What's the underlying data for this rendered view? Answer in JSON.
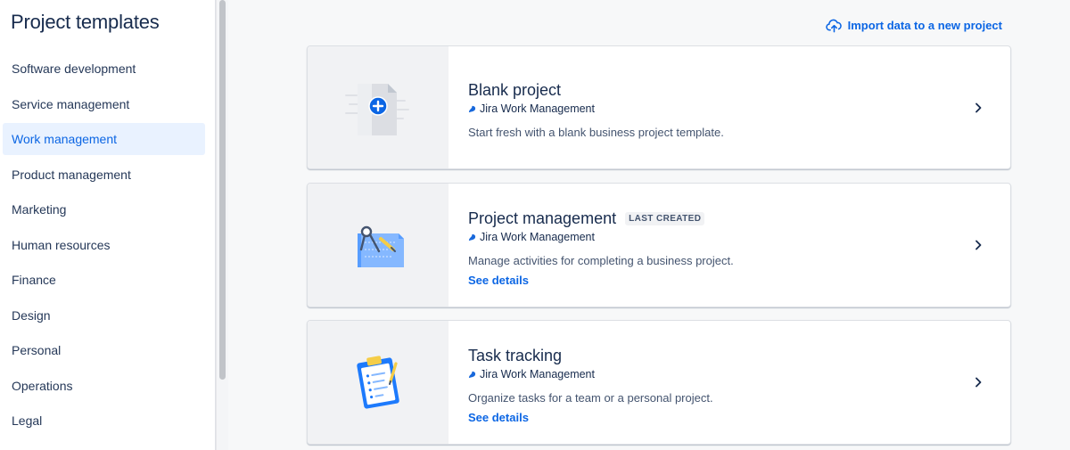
{
  "sidebar": {
    "title": "Project templates",
    "items": [
      {
        "label": "Software development"
      },
      {
        "label": "Service management"
      },
      {
        "label": "Work management",
        "active": true
      },
      {
        "label": "Product management"
      },
      {
        "label": "Marketing"
      },
      {
        "label": "Human resources"
      },
      {
        "label": "Finance"
      },
      {
        "label": "Design"
      },
      {
        "label": "Personal"
      },
      {
        "label": "Operations"
      },
      {
        "label": "Legal"
      }
    ]
  },
  "main": {
    "import_label": "Import data to a new project",
    "cards": [
      {
        "title": "Blank project",
        "product": "Jira Work Management",
        "description": "Start fresh with a blank business project template.",
        "icon": "blank-document-plus-icon"
      },
      {
        "title": "Project management",
        "badge": "LAST CREATED",
        "product": "Jira Work Management",
        "description": "Manage activities for completing a business project.",
        "link": "See details",
        "icon": "blueprint-compass-icon"
      },
      {
        "title": "Task tracking",
        "product": "Jira Work Management",
        "description": "Organize tasks for a team or a personal project.",
        "link": "See details",
        "icon": "clipboard-checklist-icon"
      }
    ]
  },
  "colors": {
    "accent": "#0c66e4",
    "active_bg": "#e9f2ff",
    "text": "#172b4d"
  }
}
